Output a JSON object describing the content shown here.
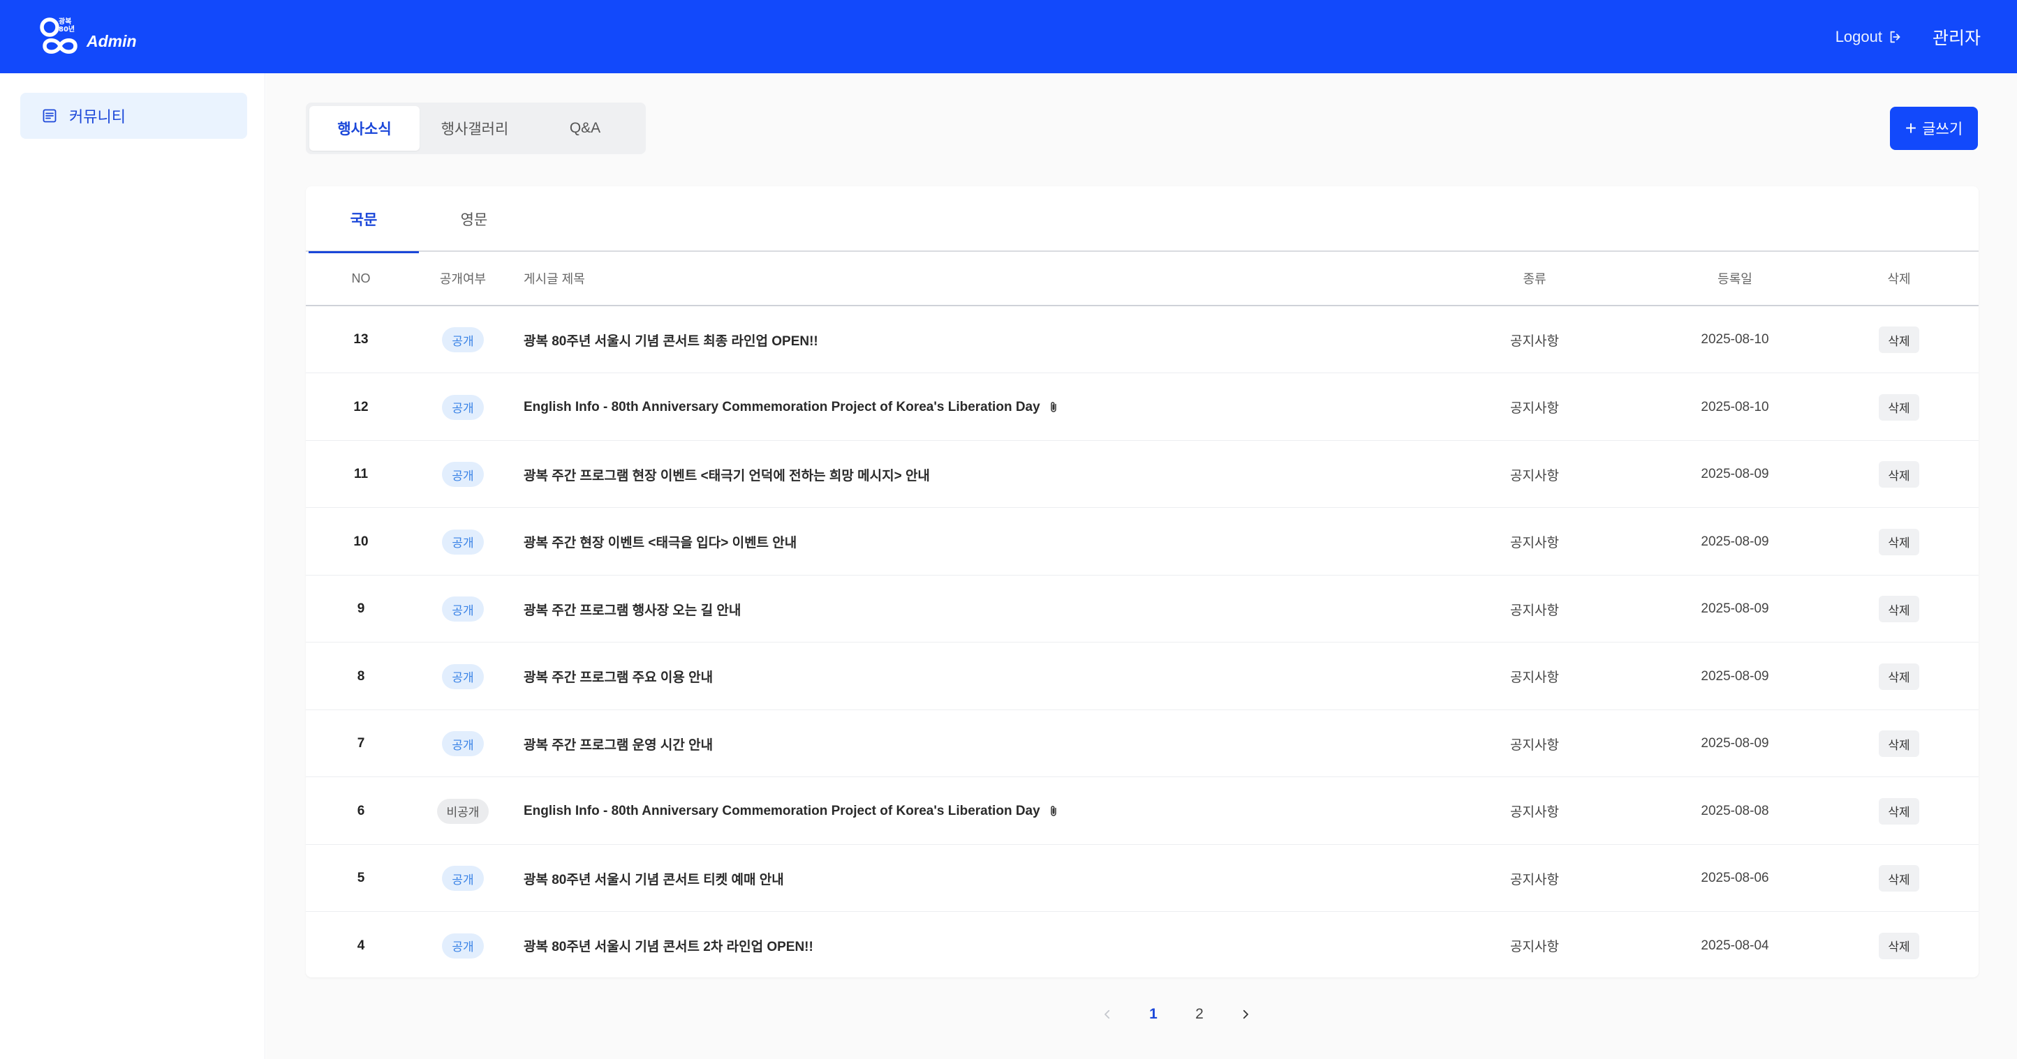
{
  "header": {
    "logo_mark_text": "광복\n80년",
    "logo_text": "Admin",
    "logout_label": "Logout",
    "user_name": "관리자"
  },
  "sidebar": {
    "items": [
      {
        "label": "커뮤니티",
        "icon": "document-list-icon",
        "active": true
      }
    ]
  },
  "category_tabs": [
    {
      "label": "행사소식",
      "active": true
    },
    {
      "label": "행사갤러리",
      "active": false
    },
    {
      "label": "Q&A",
      "active": false
    }
  ],
  "write_button_label": "글쓰기",
  "language_tabs": [
    {
      "label": "국문",
      "active": true
    },
    {
      "label": "영문",
      "active": false
    }
  ],
  "table": {
    "columns": {
      "no": "NO",
      "public": "공개여부",
      "title": "게시글 제목",
      "type": "종류",
      "date": "등록일",
      "delete": "삭제"
    },
    "rows": [
      {
        "no": "13",
        "status": "공개",
        "title": "광복 80주년 서울시 기념 콘서트 최종 라인업 OPEN!!",
        "attachment": false,
        "type": "공지사항",
        "date": "2025-08-10",
        "delete": "삭제"
      },
      {
        "no": "12",
        "status": "공개",
        "title": "English Info - 80th Anniversary Commemoration Project of Korea's Liberation Day",
        "attachment": true,
        "type": "공지사항",
        "date": "2025-08-10",
        "delete": "삭제"
      },
      {
        "no": "11",
        "status": "공개",
        "title": "광복 주간 프로그램 현장 이벤트 <태극기 언덕에 전하는 희망 메시지> 안내",
        "attachment": false,
        "type": "공지사항",
        "date": "2025-08-09",
        "delete": "삭제"
      },
      {
        "no": "10",
        "status": "공개",
        "title": "광복 주간 현장 이벤트 <태극을 입다> 이벤트 안내",
        "attachment": false,
        "type": "공지사항",
        "date": "2025-08-09",
        "delete": "삭제"
      },
      {
        "no": "9",
        "status": "공개",
        "title": "광복 주간 프로그램 행사장 오는 길 안내",
        "attachment": false,
        "type": "공지사항",
        "date": "2025-08-09",
        "delete": "삭제"
      },
      {
        "no": "8",
        "status": "공개",
        "title": "광복 주간 프로그램 주요 이용 안내",
        "attachment": false,
        "type": "공지사항",
        "date": "2025-08-09",
        "delete": "삭제"
      },
      {
        "no": "7",
        "status": "공개",
        "title": "광복 주간 프로그램 운영 시간 안내",
        "attachment": false,
        "type": "공지사항",
        "date": "2025-08-09",
        "delete": "삭제"
      },
      {
        "no": "6",
        "status": "비공개",
        "title": "English Info - 80th Anniversary Commemoration Project of Korea's Liberation Day",
        "attachment": true,
        "type": "공지사항",
        "date": "2025-08-08",
        "delete": "삭제"
      },
      {
        "no": "5",
        "status": "공개",
        "title": "광복 80주년 서울시 기념 콘서트 티켓 예매 안내",
        "attachment": false,
        "type": "공지사항",
        "date": "2025-08-06",
        "delete": "삭제"
      },
      {
        "no": "4",
        "status": "공개",
        "title": "광복 80주년 서울시 기념 콘서트 2차 라인업 OPEN!!",
        "attachment": false,
        "type": "공지사항",
        "date": "2025-08-04",
        "delete": "삭제"
      }
    ]
  },
  "pagination": {
    "pages": [
      "1",
      "2"
    ],
    "current": "1"
  },
  "colors": {
    "brand": "#1249fb",
    "accent_text": "#1b47d9",
    "public_badge_bg": "#e2eefd",
    "public_badge_text": "#3a83e6",
    "private_badge_bg": "#ebecee"
  }
}
